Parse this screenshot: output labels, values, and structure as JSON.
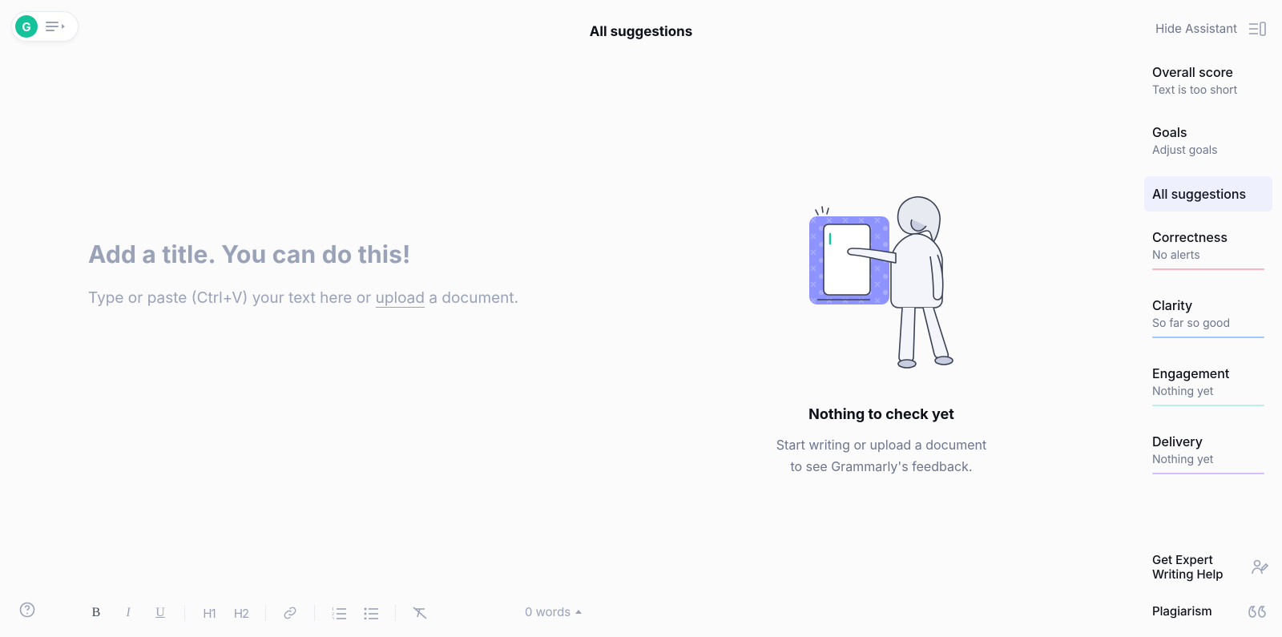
{
  "header": {
    "title": "All suggestions",
    "hide_assistant": "Hide Assistant"
  },
  "editor": {
    "title_placeholder": "Add a title. You can do this!",
    "body_prefix": "Type or paste (Ctrl+V) your text here or ",
    "upload_word": "upload",
    "body_suffix": " a document."
  },
  "empty_state": {
    "heading": "Nothing to check yet",
    "line1": "Start writing or upload a document",
    "line2": "to see Grammarly's feedback."
  },
  "sidebar": {
    "score": {
      "label": "Overall score",
      "sub": "Text is too short"
    },
    "goals": {
      "label": "Goals",
      "sub": "Adjust goals"
    },
    "all": {
      "label": "All suggestions"
    },
    "correctness": {
      "label": "Correctness",
      "sub": "No alerts"
    },
    "clarity": {
      "label": "Clarity",
      "sub": "So far so good"
    },
    "engagement": {
      "label": "Engagement",
      "sub": "Nothing yet"
    },
    "delivery": {
      "label": "Delivery",
      "sub": "Nothing yet"
    },
    "expert": "Get Expert Writing Help",
    "plagiarism": "Plagiarism"
  },
  "footer": {
    "wordcount": "0 words"
  },
  "icons": {
    "bold": "B",
    "italic": "I",
    "underline": "U",
    "h1": "H1",
    "h2": "H2"
  }
}
